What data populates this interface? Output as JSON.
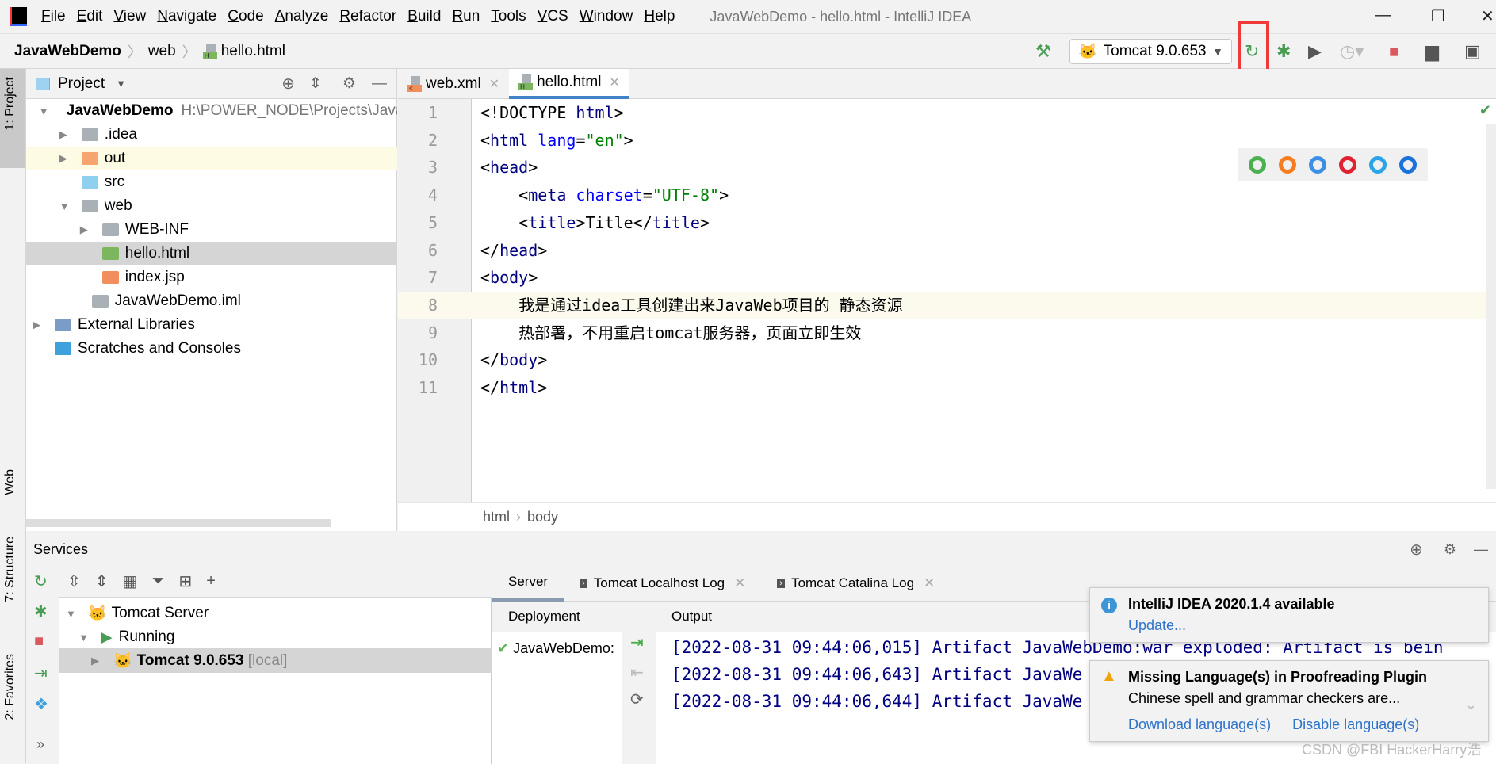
{
  "app": {
    "title": "JavaWebDemo - hello.html - IntelliJ IDEA",
    "menu": [
      "File",
      "Edit",
      "View",
      "Navigate",
      "Code",
      "Analyze",
      "Refactor",
      "Build",
      "Run",
      "Tools",
      "VCS",
      "Window",
      "Help"
    ]
  },
  "nav": {
    "crumbs": [
      "JavaWebDemo",
      "web",
      "hello.html"
    ],
    "run_config": "Tomcat 9.0.653"
  },
  "sidebar": {
    "left_tabs": [
      "1: Project",
      "Web",
      "7: Structure",
      "2: Favorites"
    ]
  },
  "project": {
    "title": "Project",
    "tree": [
      {
        "label": "JavaWebDemo",
        "path": "H:\\POWER_NODE\\Projects\\Java",
        "icon": "module-folder-icon",
        "color": "#9aa4ad",
        "arrow": "▼",
        "depth": 0,
        "bold": true
      },
      {
        "label": ".idea",
        "icon": "folder-icon",
        "color": "#a9b0b6",
        "arrow": "▶",
        "depth": 1
      },
      {
        "label": "out",
        "icon": "excluded-folder-icon",
        "color": "#f7a56e",
        "arrow": "▶",
        "depth": 1,
        "highlight": true
      },
      {
        "label": "src",
        "icon": "source-folder-icon",
        "color": "#8fd0ee",
        "arrow": "",
        "depth": 1
      },
      {
        "label": "web",
        "icon": "web-folder-icon",
        "color": "#a9b0b6",
        "arrow": "▼",
        "depth": 1
      },
      {
        "label": "WEB-INF",
        "icon": "folder-icon",
        "color": "#a9b0b6",
        "arrow": "▶",
        "depth": 2
      },
      {
        "label": "hello.html",
        "icon": "html-file-icon",
        "color": "#7cb65f",
        "arrow": "",
        "depth": 2,
        "selected": true
      },
      {
        "label": "index.jsp",
        "icon": "jsp-file-icon",
        "color": "#f18e5c",
        "arrow": "",
        "depth": 2
      },
      {
        "label": "JavaWebDemo.iml",
        "icon": "iml-file-icon",
        "color": "#a9b0b6",
        "arrow": "",
        "depth": 1.5
      },
      {
        "label": "External Libraries",
        "icon": "libraries-icon",
        "color": "#7a9cc6",
        "arrow": "▶",
        "depth": -0.3
      },
      {
        "label": "Scratches and Consoles",
        "icon": "scratches-icon",
        "color": "#3fa1dc",
        "arrow": "",
        "depth": -0.3
      }
    ]
  },
  "editor": {
    "tabs": [
      {
        "label": "web.xml",
        "active": false
      },
      {
        "label": "hello.html",
        "active": true
      }
    ],
    "lines": [
      [
        [
          "",
          "<!DOCTYPE "
        ],
        [
          "tg",
          "html"
        ],
        [
          "",
          ">"
        ]
      ],
      [
        [
          "",
          "<"
        ],
        [
          "tg",
          "html"
        ],
        [
          "at",
          " lang"
        ],
        [
          "",
          "="
        ],
        [
          "st",
          "\"en\""
        ],
        [
          "",
          ">"
        ]
      ],
      [
        [
          "",
          "<"
        ],
        [
          "tg",
          "head"
        ],
        [
          "",
          ">"
        ]
      ],
      [
        [
          "",
          "    <"
        ],
        [
          "tg",
          "meta"
        ],
        [
          "at",
          " charset"
        ],
        [
          "",
          "="
        ],
        [
          "st",
          "\"UTF-8\""
        ],
        [
          "",
          ">"
        ]
      ],
      [
        [
          "",
          "    <"
        ],
        [
          "tg",
          "title"
        ],
        [
          "",
          ">Title</"
        ],
        [
          "tg",
          "title"
        ],
        [
          "",
          ">"
        ]
      ],
      [
        [
          "",
          "</"
        ],
        [
          "tg",
          "head"
        ],
        [
          "",
          ">"
        ]
      ],
      [
        [
          "",
          "<"
        ],
        [
          "tg",
          "body"
        ],
        [
          "",
          ">"
        ]
      ],
      [
        [
          "",
          "    我是通过idea工具创建出来JavaWeb项目的 静态资源"
        ]
      ],
      [
        [
          "",
          "    热部署，不用重启tomcat服务器，页面立即生效"
        ]
      ],
      [
        [
          "",
          "</"
        ],
        [
          "tg",
          "body"
        ],
        [
          "",
          ">"
        ]
      ],
      [
        [
          "",
          "</"
        ],
        [
          "tg",
          "html"
        ],
        [
          "",
          ">"
        ]
      ]
    ],
    "current_line": 8,
    "breadcrumb": [
      "html",
      "body"
    ]
  },
  "browsers": [
    {
      "name": "chrome-icon",
      "color": "#4caf50"
    },
    {
      "name": "firefox-icon",
      "color": "#f57c1f"
    },
    {
      "name": "safari-icon",
      "color": "#3d8fe6"
    },
    {
      "name": "opera-icon",
      "color": "#e0212f"
    },
    {
      "name": "ie-icon",
      "color": "#2aa4e6"
    },
    {
      "name": "edge-icon",
      "color": "#1a73d9"
    }
  ],
  "services": {
    "title": "Services",
    "tree": [
      {
        "label": "Tomcat Server"
      },
      {
        "label": "Running"
      },
      {
        "label": "Tomcat 9.0.653",
        "suffix": "[local]"
      }
    ],
    "tabs": [
      "Server",
      "Tomcat Localhost Log",
      "Tomcat Catalina Log"
    ],
    "deployment_header": "Deployment",
    "output_header": "Output",
    "deployment": "JavaWebDemo:",
    "output": [
      "[2022-08-31 09:44:06,015] Artifact JavaWebDemo:war exploded: Artifact is bein",
      "[2022-08-31 09:44:06,643] Artifact JavaWe",
      "[2022-08-31 09:44:06,644] Artifact JavaWe"
    ]
  },
  "notifications": [
    {
      "title": "IntelliJ IDEA 2020.1.4 available",
      "links": [
        "Update..."
      ]
    },
    {
      "title": "Missing Language(s) in Proofreading Plugin",
      "body": "Chinese spell and grammar checkers are...",
      "links": [
        "Download language(s)",
        "Disable language(s)"
      ]
    }
  ],
  "watermark": "CSDN @FBI HackerHarry浩",
  "colors": {
    "accent": "#4083c9",
    "highlight_box": "#f03a3a",
    "run_green": "#499c54",
    "stop_red": "#db5860"
  }
}
